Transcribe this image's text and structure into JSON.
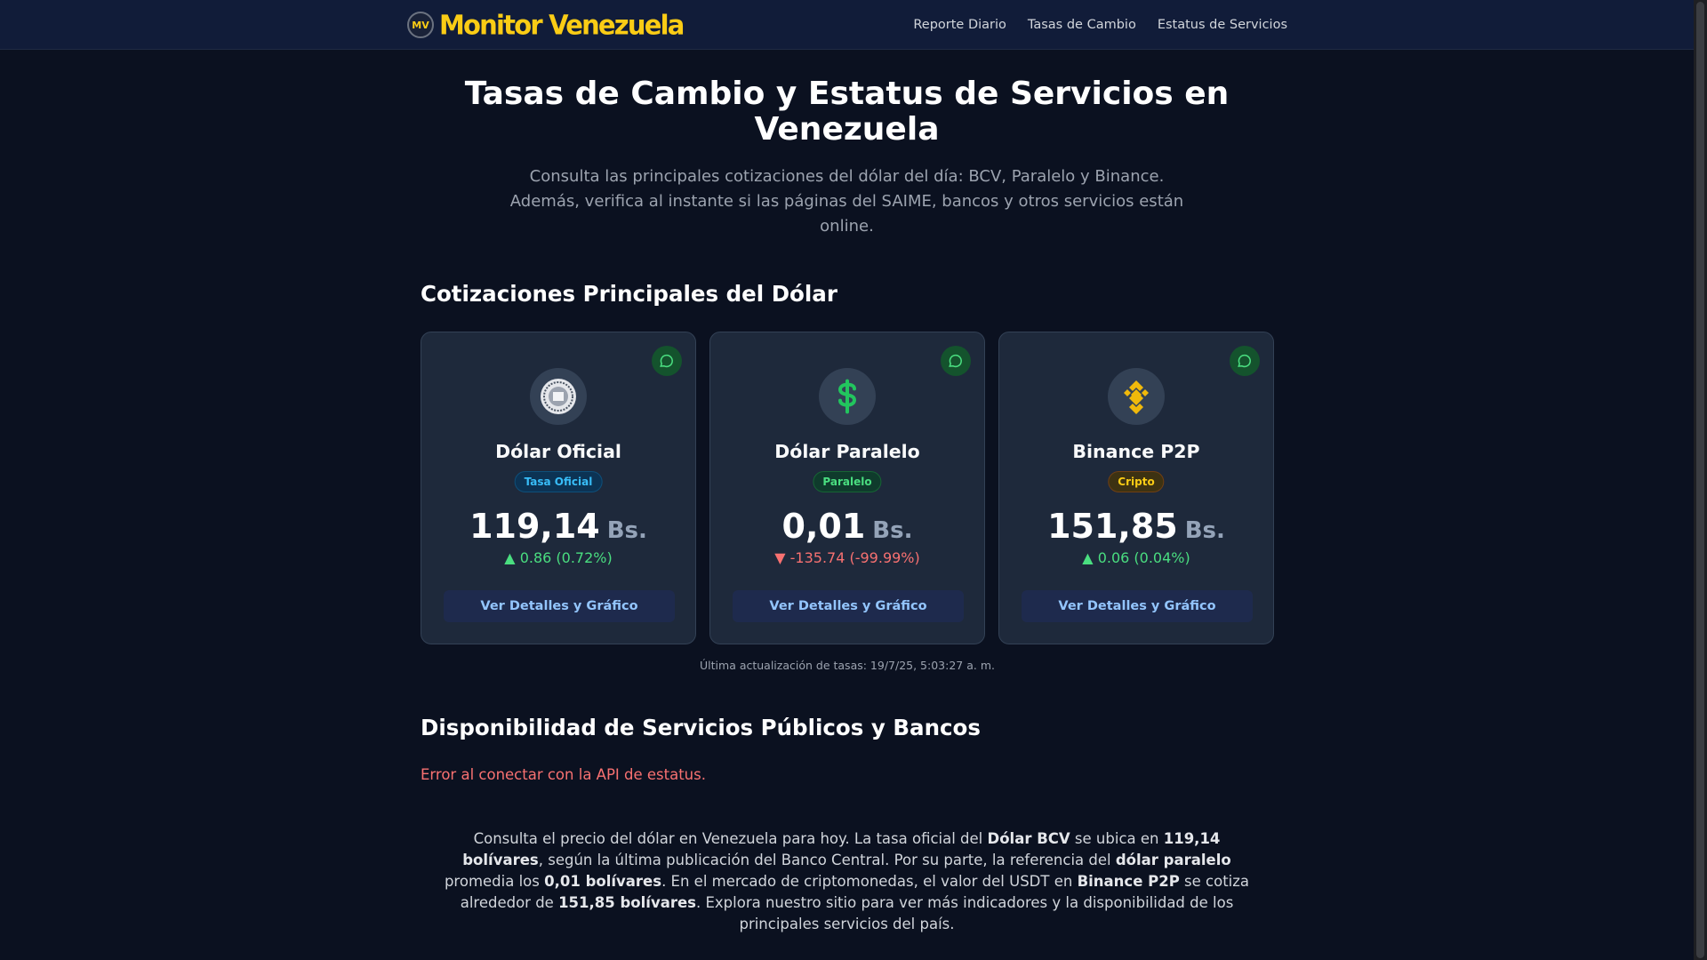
{
  "header": {
    "logo_badge": "MV",
    "logo_text": "Monitor Venezuela",
    "nav": [
      "Reporte Diario",
      "Tasas de Cambio",
      "Estatus de Servicios"
    ]
  },
  "hero": {
    "title": "Tasas de Cambio y Estatus de Servicios en Venezuela",
    "subtitle": "Consulta las principales cotizaciones del dólar del día: BCV, Paralelo y Binance. Además, verifica al instante si las páginas del SAIME, bancos y otros servicios están online."
  },
  "rates_section": {
    "title": "Cotizaciones Principales del Dólar",
    "cards": [
      {
        "name": "Dólar Oficial",
        "tag": "Tasa Oficial",
        "value": "119,14",
        "currency": "Bs.",
        "change": "0.86 (0.72%)",
        "direction": "up",
        "button": "Ver Detalles y Gráfico",
        "icon": "bcv-seal-icon"
      },
      {
        "name": "Dólar Paralelo",
        "tag": "Paralelo",
        "value": "0,01",
        "currency": "Bs.",
        "change": "-135.74 (-99.99%)",
        "direction": "down",
        "button": "Ver Detalles y Gráfico",
        "icon": "dollar-sign-icon"
      },
      {
        "name": "Binance P2P",
        "tag": "Cripto",
        "value": "151,85",
        "currency": "Bs.",
        "change": "0.06 (0.04%)",
        "direction": "up",
        "button": "Ver Detalles y Gráfico",
        "icon": "binance-icon"
      }
    ],
    "updated": "Última actualización de tasas: 19/7/25, 5:03:27 a. m."
  },
  "services_section": {
    "title": "Disponibilidad de Servicios Públicos y Bancos",
    "error": "Error al conectar con la API de estatus."
  },
  "seo": {
    "t1": "Consulta el precio del dólar en Venezuela para hoy. La tasa oficial del ",
    "b1": "Dólar BCV",
    "t2": " se ubica en ",
    "b2": "119,14 bolívares",
    "t3": ", según la última publicación del Banco Central. Por su parte, la referencia del ",
    "b3": "dólar paralelo",
    "t4": " promedia los ",
    "b4": "0,01 bolívares",
    "t5": ". En el mercado de criptomonedas, el valor del USDT en ",
    "b5": "Binance P2P",
    "t6": " se cotiza alrededor de ",
    "b6": "151,85 bolívares",
    "t7": ". Explora nuestro sitio para ver más indicadores y la disponibilidad de los principales servicios del país."
  },
  "colors": {
    "background": "#0b1120",
    "header": "#111c39",
    "logo": "#facc15",
    "up": "#4ade80",
    "down": "#f87171"
  }
}
